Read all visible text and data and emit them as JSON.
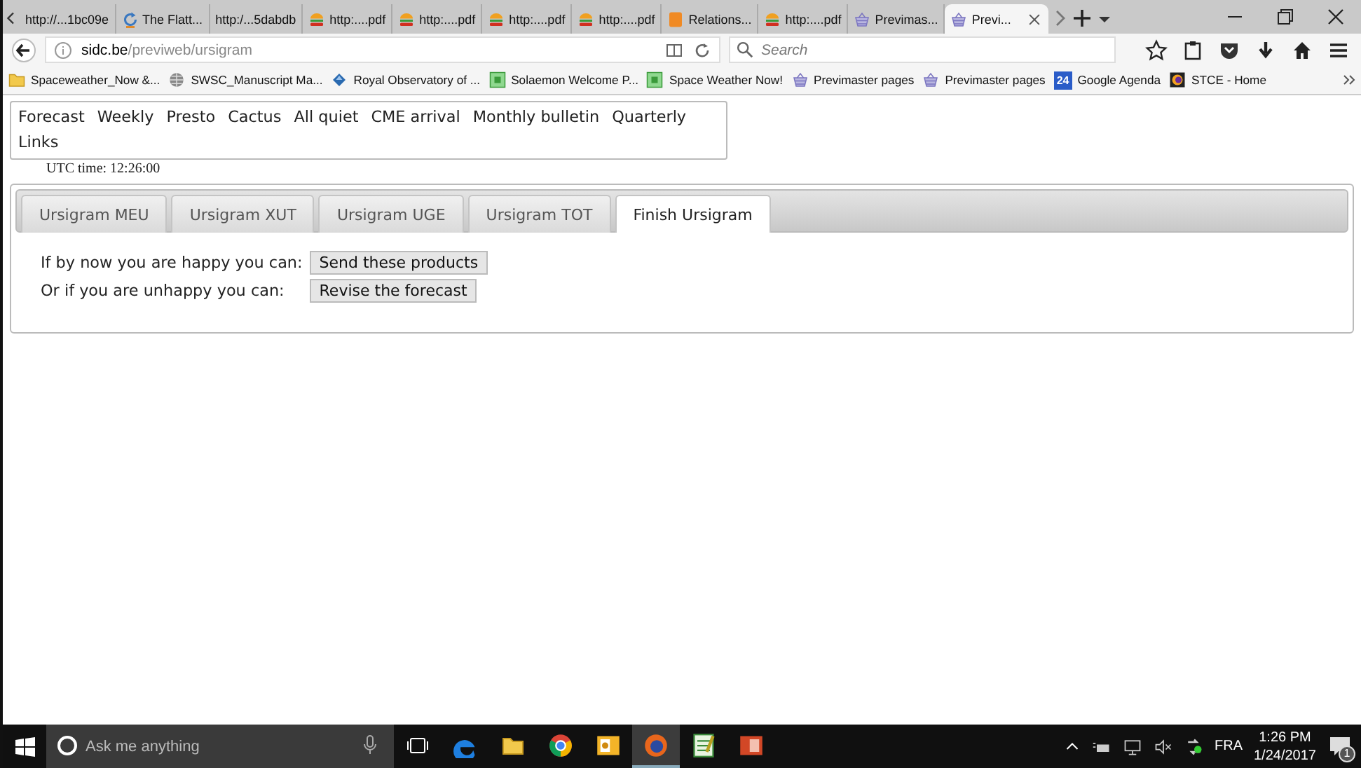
{
  "browser": {
    "tabs": [
      {
        "title": "http://...1bc09e",
        "kind": "plain",
        "selected": false
      },
      {
        "title": "The Flatt...",
        "kind": "refresh",
        "selected": false
      },
      {
        "title": "http:/...5dabdb",
        "kind": "plain",
        "selected": false
      },
      {
        "title": "http:....pdf",
        "kind": "burger",
        "selected": false
      },
      {
        "title": "http:....pdf",
        "kind": "burger",
        "selected": false
      },
      {
        "title": "http:....pdf",
        "kind": "burger",
        "selected": false
      },
      {
        "title": "http:....pdf",
        "kind": "burger",
        "selected": false
      },
      {
        "title": "Relations...",
        "kind": "tile",
        "selected": false
      },
      {
        "title": "http:....pdf",
        "kind": "burger",
        "selected": false
      },
      {
        "title": "Previmas...",
        "kind": "basket",
        "selected": false
      },
      {
        "title": "Previ...",
        "kind": "basket",
        "selected": true
      }
    ],
    "url": {
      "host": "sidc.be",
      "path": "/previweb/ursigram"
    },
    "search": {
      "placeholder": "Search"
    },
    "bookmarks": [
      {
        "label": "Spaceweather_Now &...",
        "kind": "folder"
      },
      {
        "label": "SWSC_Manuscript Ma...",
        "kind": "globe"
      },
      {
        "label": "Royal Observatory of ...",
        "kind": "drop"
      },
      {
        "label": "Solaemon Welcome P...",
        "kind": "app"
      },
      {
        "label": "Space Weather Now!",
        "kind": "app"
      },
      {
        "label": "Previmaster pages",
        "kind": "basket"
      },
      {
        "label": "Previmaster pages",
        "kind": "basket"
      },
      {
        "label": "Google Agenda",
        "kind": "calendar",
        "badge": "24"
      },
      {
        "label": "STCE - Home",
        "kind": "stce"
      }
    ]
  },
  "page": {
    "menu": [
      "Forecast",
      "Weekly",
      "Presto",
      "Cactus",
      "All quiet",
      "CME arrival",
      "Monthly bulletin",
      "Quarterly",
      "Links"
    ],
    "utc_time": "UTC time: 12:26:00",
    "tabs": [
      {
        "label": "Ursigram MEU",
        "selected": false
      },
      {
        "label": "Ursigram XUT",
        "selected": false
      },
      {
        "label": "Ursigram UGE",
        "selected": false
      },
      {
        "label": "Ursigram TOT",
        "selected": false
      },
      {
        "label": "Finish Ursigram",
        "selected": true
      }
    ],
    "rows": [
      {
        "label": "If by now you are happy you can:",
        "button": "Send these products"
      },
      {
        "label": "Or if you are unhappy you can:",
        "button": "Revise the forecast"
      }
    ]
  },
  "taskbar": {
    "search": {
      "placeholder": "Ask me anything"
    },
    "apps": [
      {
        "kind": "task-view",
        "selected": false
      },
      {
        "kind": "edge",
        "selected": false
      },
      {
        "kind": "folder",
        "selected": false
      },
      {
        "kind": "chrome",
        "selected": false
      },
      {
        "kind": "outlook",
        "selected": false
      },
      {
        "kind": "firefox",
        "selected": true
      },
      {
        "kind": "sheet",
        "selected": false
      },
      {
        "kind": "slides",
        "selected": false
      }
    ],
    "language": "FRA",
    "time": "1:26 PM",
    "date": "1/24/2017",
    "notifications": "1"
  }
}
